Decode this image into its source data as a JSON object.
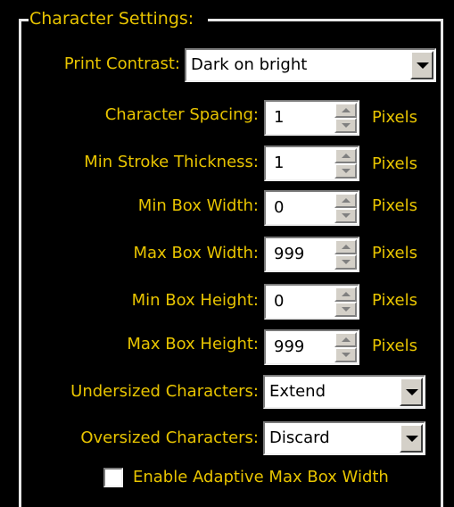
{
  "group_title": "Character Settings:",
  "print_contrast": {
    "label": "Print Contrast:",
    "value": "Dark on bright"
  },
  "character_spacing": {
    "label": "Character Spacing:",
    "value": "1",
    "unit": "Pixels"
  },
  "min_stroke_thickness": {
    "label": "Min Stroke Thickness:",
    "value": "1",
    "unit": "Pixels"
  },
  "min_box_width": {
    "label": "Min Box Width:",
    "value": "0",
    "unit": "Pixels"
  },
  "max_box_width": {
    "label": "Max Box Width:",
    "value": "999",
    "unit": "Pixels"
  },
  "min_box_height": {
    "label": "Min Box Height:",
    "value": "0",
    "unit": "Pixels"
  },
  "max_box_height": {
    "label": "Max Box Height:",
    "value": "999",
    "unit": "Pixels"
  },
  "undersized_characters": {
    "label": "Undersized Characters:",
    "value": "Extend"
  },
  "oversized_characters": {
    "label": "Oversized Characters:",
    "value": "Discard"
  },
  "adaptive_max_box_width": {
    "label": "Enable Adaptive Max Box Width",
    "checked": false
  },
  "colors": {
    "label_text": "#e8c400",
    "background": "#000000",
    "frame": "#e8e8e8"
  }
}
